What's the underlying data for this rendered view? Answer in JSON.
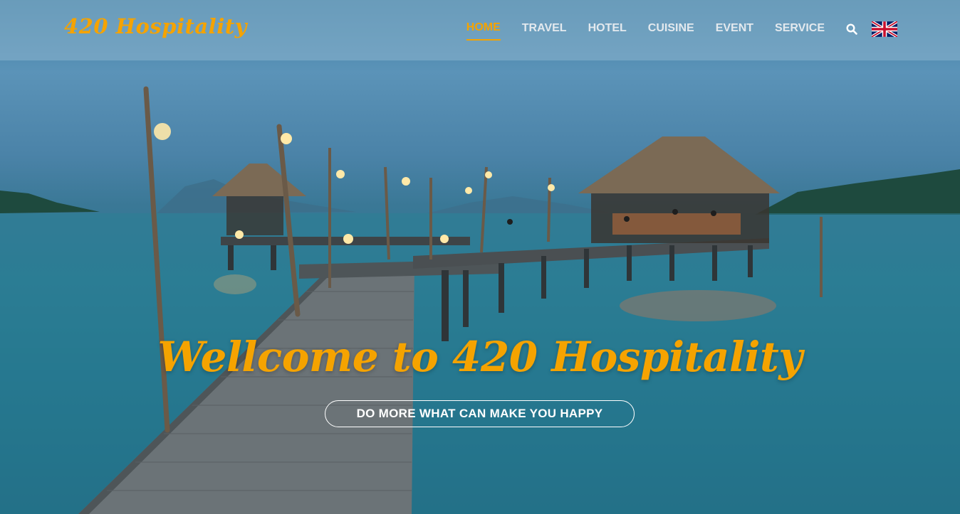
{
  "brand": {
    "logo_text": "420 Hospitality",
    "accent_color": "#f5a300"
  },
  "nav": {
    "items": [
      {
        "label": "HOME",
        "active": true
      },
      {
        "label": "TRAVEL"
      },
      {
        "label": "HOTEL"
      },
      {
        "label": "CUISINE"
      },
      {
        "label": "EVENT"
      },
      {
        "label": "SERVICE"
      }
    ],
    "search_icon": "search-icon",
    "language_icon": "uk-flag-icon"
  },
  "hero": {
    "headline": "Wellcome to 420 Hospitality",
    "cta_label": "DO MORE WHAT CAN MAKE YOU HAPPY"
  }
}
